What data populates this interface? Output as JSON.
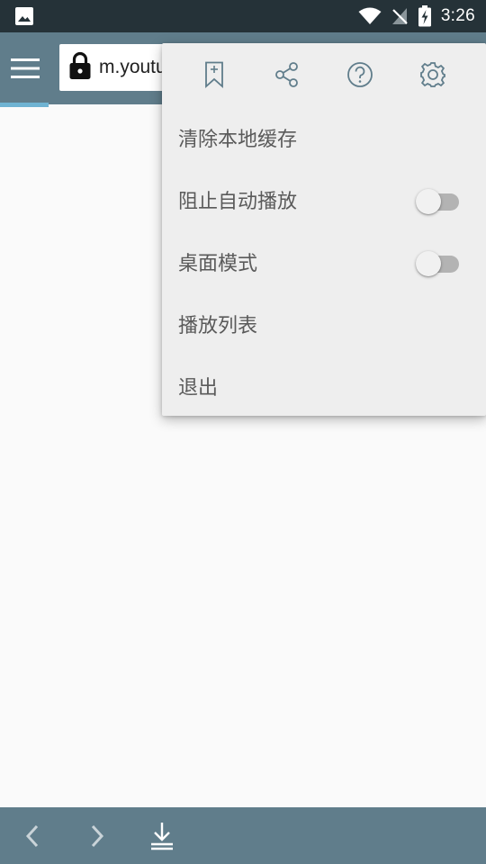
{
  "status_bar": {
    "time": "3:26",
    "icons": [
      "image-notification-icon",
      "wifi-icon",
      "no-sim-icon",
      "battery-charging-icon"
    ]
  },
  "toolbar": {
    "menu_icon": "hamburger-menu-icon",
    "url": "m.youtube.com",
    "lock_icon": "lock-icon",
    "colors": {
      "background": "#607d8b",
      "status_bar": "#253238",
      "progress": "#6fb3d2"
    }
  },
  "overflow_menu": {
    "icons": [
      "bookmark-add-icon",
      "share-icon",
      "help-icon",
      "settings-icon"
    ],
    "items": [
      {
        "label": "清除本地缓存"
      },
      {
        "label": "阻止自动播放",
        "toggle": false
      },
      {
        "label": "桌面模式",
        "toggle": false
      },
      {
        "label": "播放列表"
      },
      {
        "label": "退出"
      }
    ]
  },
  "bottom_bar": {
    "buttons": [
      "back-icon",
      "forward-icon",
      "download-icon"
    ]
  }
}
